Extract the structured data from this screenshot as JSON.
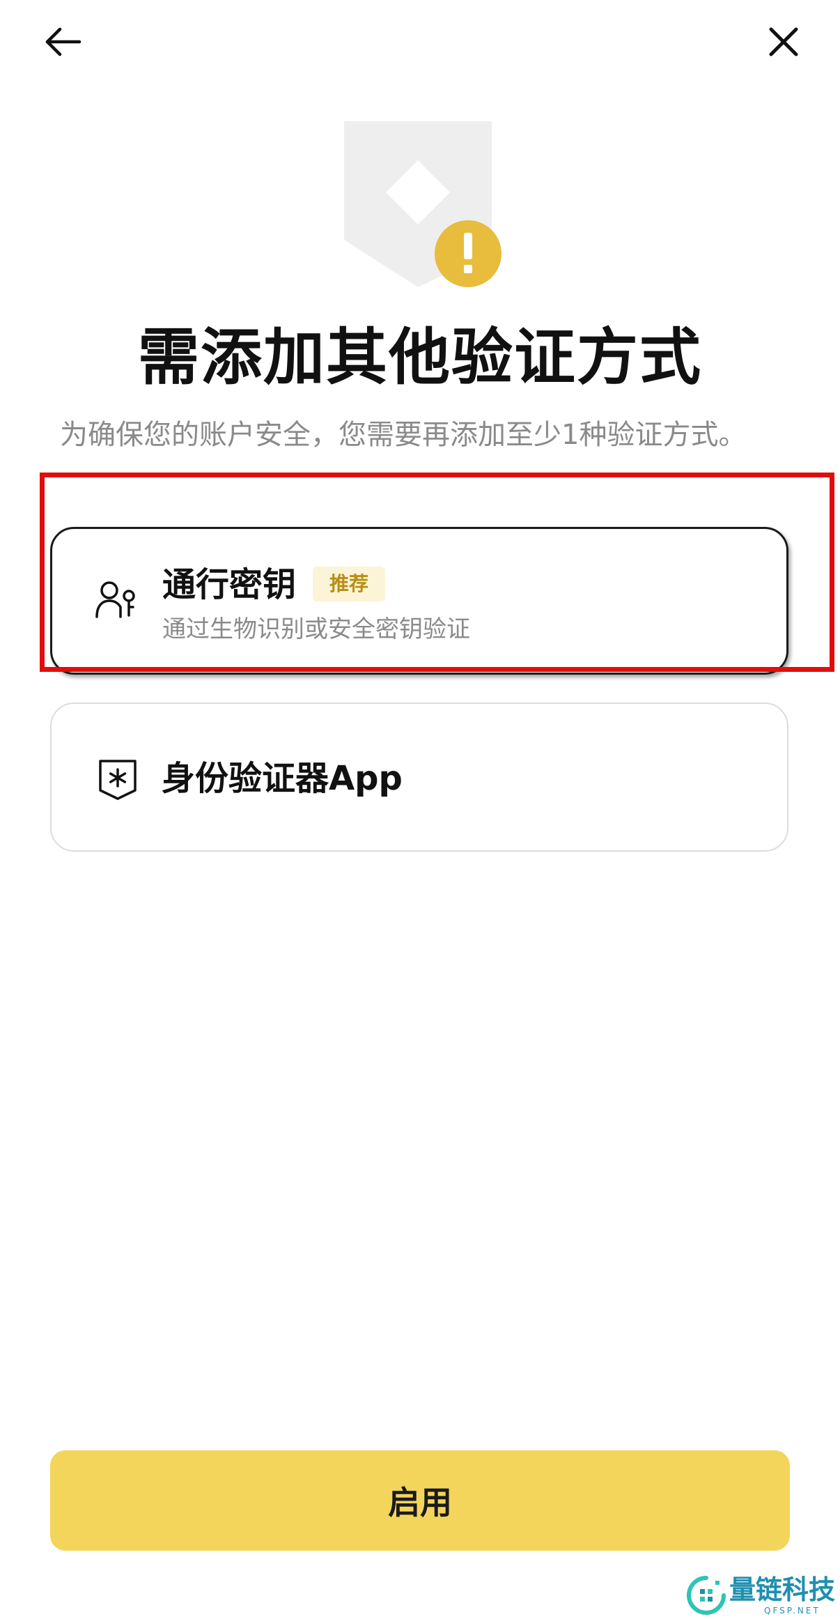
{
  "header": {
    "back_icon": "arrow-left-icon",
    "close_icon": "close-icon"
  },
  "hero": {
    "icon": "shield-warning-icon",
    "warning_color": "#e8bc3c",
    "shield_color": "#eeeeef"
  },
  "page": {
    "title": "需添加其他验证方式",
    "subtitle": "为确保您的账户安全，您需要再添加至少1种验证方式。"
  },
  "options": [
    {
      "icon": "passkey-icon",
      "title": "通行密钥",
      "badge": "推荐",
      "description": "通过生物识别或安全密钥验证",
      "selected": true
    },
    {
      "icon": "authenticator-shield-icon",
      "title": "身份验证器App",
      "selected": false
    }
  ],
  "footer": {
    "enable_label": "启用",
    "button_color": "#f3d55b"
  },
  "watermark": {
    "text": "量链科技",
    "subtext": "QFSP.NET",
    "color": "#1f8fb0"
  },
  "annotation": {
    "highlight_color": "#e10d0d"
  }
}
